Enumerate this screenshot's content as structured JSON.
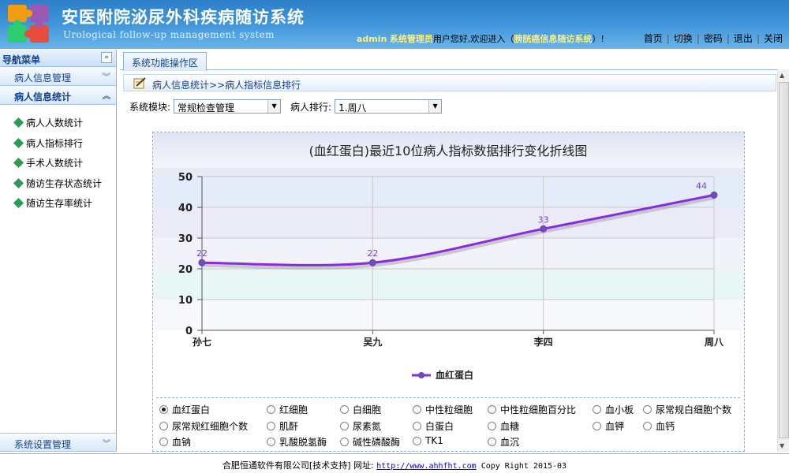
{
  "header": {
    "title": "安医附院泌尿外科疾病随访系统",
    "subtitle": "Urological follow-up management system",
    "user": "admin",
    "role": "系统管理员",
    "welcome_prefix": "用户您好,欢迎进入（",
    "system_name": "膀胱癌信息随访系统",
    "welcome_suffix": "）!",
    "links": [
      "首页",
      "切换",
      "密码",
      "退出",
      "关闭"
    ]
  },
  "sidebar": {
    "header": "导航菜单",
    "collapse_icon": "double-chevron-left-icon",
    "groups": [
      {
        "label": "病人信息管理",
        "expanded": false
      },
      {
        "label": "病人信息统计",
        "expanded": true
      }
    ],
    "items": [
      "病人人数统计",
      "病人指标排行",
      "手术人数统计",
      "随访生存状态统计",
      "随访生存率统计"
    ],
    "bottom_group": "系统设置管理"
  },
  "main": {
    "tab": "系统功能操作区",
    "breadcrumb": "病人信息统计>>病人指标信息排行",
    "filters": {
      "module_label": "系统模块:",
      "module_value": "常规检查管理",
      "rank_label": "病人排行:",
      "rank_value": "1.周八"
    }
  },
  "chart_data": {
    "type": "line",
    "title": "(血红蛋白)最近10位病人指标数据排行变化折线图",
    "categories": [
      "孙七",
      "吴九",
      "李四",
      "周八"
    ],
    "series": [
      {
        "name": "血红蛋白",
        "values": [
          22,
          22,
          33,
          44
        ],
        "color": "#8a2be2"
      }
    ],
    "ylim": [
      0,
      50
    ],
    "yticks": [
      0,
      10,
      20,
      30,
      40,
      50
    ],
    "grid": true,
    "legend": "bottom-center",
    "data_labels": true,
    "smooth": true
  },
  "series_options": {
    "selected": "血红蛋白",
    "rows": [
      [
        "血红蛋白",
        "红细胞",
        "白细胞",
        "中性粒细胞",
        "中性粒细胞百分比",
        "血小板",
        "尿常规白细胞个数"
      ],
      [
        "尿常规红细胞个数",
        "肌酐",
        "尿素氮",
        "白蛋白",
        "血糖",
        "血钾",
        "血钙"
      ],
      [
        "血钠",
        "乳酸脱氢酶",
        "碱性磷酸酶",
        "TK1",
        "血沉"
      ]
    ]
  },
  "footer": {
    "company": "合肥恒通软件有限公司[技术支持]",
    "url_label": " 网址: ",
    "url": "http://www.ahhfht.com",
    "copyright": " Copy Right 2015-03"
  },
  "colors": {
    "header_blue": "#3d93d8",
    "nav_text": "#15428b",
    "line": "#8a2be2",
    "point": "#5a5aa8"
  }
}
